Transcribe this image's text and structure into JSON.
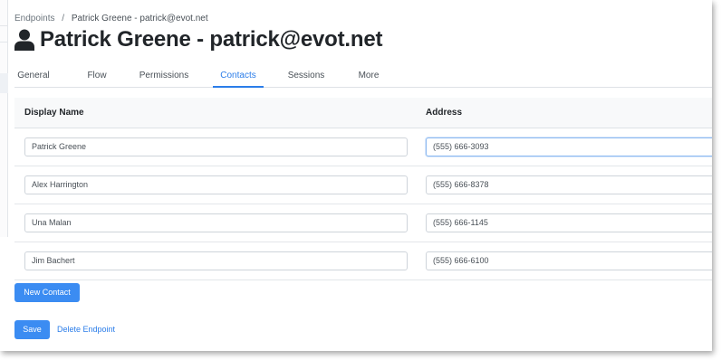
{
  "breadcrumb": {
    "parent": "Endpoints",
    "separator": "/",
    "current": "Patrick Greene - patrick@evot.net"
  },
  "page": {
    "title": "Patrick Greene - patrick@evot.net",
    "title_icon": "user-icon"
  },
  "tabs": [
    {
      "label": "General",
      "active": false
    },
    {
      "label": "Flow",
      "active": false
    },
    {
      "label": "Permissions",
      "active": false
    },
    {
      "label": "Contacts",
      "active": true
    },
    {
      "label": "Sessions",
      "active": false
    },
    {
      "label": "More",
      "active": false
    }
  ],
  "contacts_table": {
    "columns": [
      "Display Name",
      "Address"
    ],
    "rows": [
      {
        "display_name": "Patrick Greene",
        "address": "(555) 666-3093"
      },
      {
        "display_name": "Alex Harrington",
        "address": "(555) 666-8378"
      },
      {
        "display_name": "Una Malan",
        "address": "(555) 666-1145"
      },
      {
        "display_name": "Jim Bachert",
        "address": "(555) 666-6100"
      }
    ]
  },
  "actions": {
    "new_contact": "New Contact",
    "save": "Save",
    "delete_endpoint": "Delete Endpoint"
  },
  "colors": {
    "accent": "#2b7de9",
    "button": "#3b8cf2",
    "header_bg": "#f8f9fa"
  }
}
